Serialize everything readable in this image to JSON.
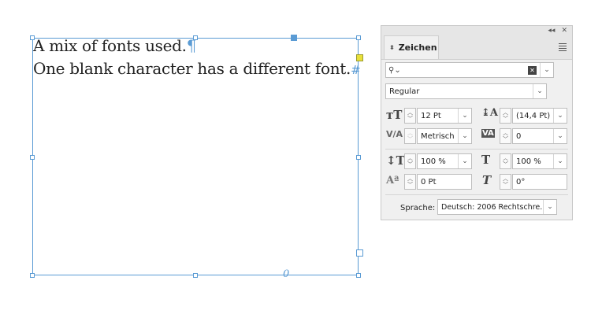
{
  "document": {
    "line1": "A mix of fonts used.",
    "line1_mark": "¶",
    "line2": "One blank character has a different font.",
    "line2_mark": "#",
    "overset_marker": "0"
  },
  "panel": {
    "title": "Zeichen",
    "collapse_glyph": "◂◂",
    "close_glyph": "✕",
    "font_search_value": "",
    "font_style": "Regular",
    "font_size": "12 Pt",
    "leading": "(14,4 Pt)",
    "kerning": "Metrisch",
    "tracking": "0",
    "vertical_scale": "100 %",
    "horizontal_scale": "100 %",
    "baseline_shift": "0 Pt",
    "skew": "0°",
    "language_label": "Sprache:",
    "language_value": "Deutsch: 2006 Rechtschre..."
  },
  "colors": {
    "frame": "#5a9bd4",
    "panel_bg": "#f0f0f0"
  },
  "icons": [
    "search-icon",
    "clear-icon",
    "font-size-icon",
    "leading-icon",
    "kerning-icon",
    "tracking-icon",
    "vertical-scale-icon",
    "horizontal-scale-icon",
    "baseline-shift-icon",
    "skew-icon"
  ]
}
